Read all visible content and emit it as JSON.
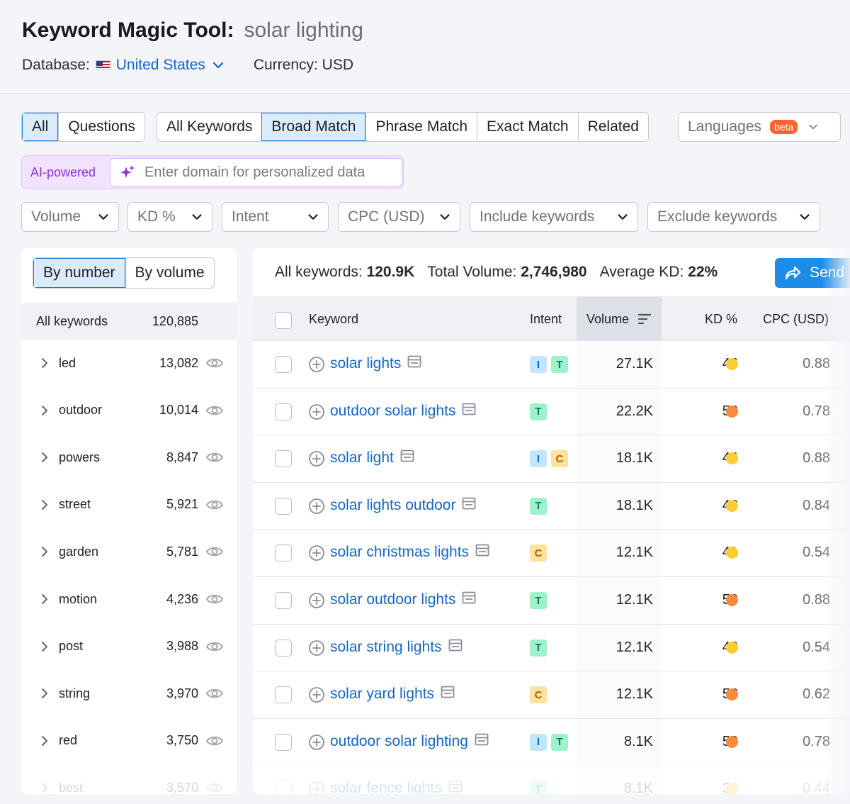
{
  "header": {
    "title": "Keyword Magic Tool:",
    "query": "solar lighting",
    "database_label": "Database:",
    "database_value": "United States",
    "currency": "Currency: USD"
  },
  "question_tabs": [
    "All",
    "Questions"
  ],
  "match_tabs": [
    "All Keywords",
    "Broad Match",
    "Phrase Match",
    "Exact Match",
    "Related"
  ],
  "languages": {
    "label": "Languages",
    "badge": "beta"
  },
  "ai": {
    "label": "AI-powered",
    "placeholder": "Enter domain for personalized data"
  },
  "filters": [
    "Volume",
    "KD %",
    "Intent",
    "CPC (USD)",
    "Include keywords",
    "Exclude keywords"
  ],
  "left_panel": {
    "toggle": [
      "By number",
      "By volume"
    ],
    "all_label": "All keywords",
    "all_count": "120,885",
    "groups": [
      {
        "name": "led",
        "count": "13,082"
      },
      {
        "name": "outdoor",
        "count": "10,014"
      },
      {
        "name": "powers",
        "count": "8,847"
      },
      {
        "name": "street",
        "count": "5,921"
      },
      {
        "name": "garden",
        "count": "5,781"
      },
      {
        "name": "motion",
        "count": "4,236"
      },
      {
        "name": "post",
        "count": "3,988"
      },
      {
        "name": "string",
        "count": "3,970"
      },
      {
        "name": "red",
        "count": "3,750"
      },
      {
        "name": "best",
        "count": "3,570"
      }
    ]
  },
  "summary": {
    "all_label": "All keywords:",
    "all_value": "120.9K",
    "volume_label": "Total Volume:",
    "volume_value": "2,746,980",
    "kd_label": "Average KD:",
    "kd_value": "22%",
    "send_label": "Send"
  },
  "table": {
    "headers": {
      "keyword": "Keyword",
      "intent": "Intent",
      "volume": "Volume",
      "kd": "KD %",
      "cpc": "CPC (USD)"
    },
    "rows": [
      {
        "keyword": "solar lights",
        "intents": [
          "I",
          "T"
        ],
        "volume": "27.1K",
        "kd": "46",
        "kd_color": "#ffcc33",
        "cpc": "0.88"
      },
      {
        "keyword": "outdoor solar lights",
        "intents": [
          "T"
        ],
        "volume": "22.2K",
        "kd": "50",
        "kd_color": "#ff8a3d",
        "cpc": "0.78"
      },
      {
        "keyword": "solar light",
        "intents": [
          "I",
          "C"
        ],
        "volume": "18.1K",
        "kd": "44",
        "kd_color": "#ffcc33",
        "cpc": "0.88"
      },
      {
        "keyword": "solar lights outdoor",
        "intents": [
          "T"
        ],
        "volume": "18.1K",
        "kd": "48",
        "kd_color": "#ffcc33",
        "cpc": "0.84"
      },
      {
        "keyword": "solar christmas lights",
        "intents": [
          "C"
        ],
        "volume": "12.1K",
        "kd": "41",
        "kd_color": "#ffcc33",
        "cpc": "0.54"
      },
      {
        "keyword": "solar outdoor lights",
        "intents": [
          "T"
        ],
        "volume": "12.1K",
        "kd": "50",
        "kd_color": "#ff8a3d",
        "cpc": "0.88"
      },
      {
        "keyword": "solar string lights",
        "intents": [
          "T"
        ],
        "volume": "12.1K",
        "kd": "40",
        "kd_color": "#ffcc33",
        "cpc": "0.54"
      },
      {
        "keyword": "solar yard lights",
        "intents": [
          "C"
        ],
        "volume": "12.1K",
        "kd": "53",
        "kd_color": "#ff8a3d",
        "cpc": "0.62"
      },
      {
        "keyword": "outdoor solar lighting",
        "intents": [
          "I",
          "T"
        ],
        "volume": "8.1K",
        "kd": "50",
        "kd_color": "#ff8a3d",
        "cpc": "0.78"
      },
      {
        "keyword": "solar fence lights",
        "intents": [
          "T"
        ],
        "volume": "8.1K",
        "kd": "38",
        "kd_color": "#ffcc33",
        "cpc": "0.44"
      }
    ]
  },
  "colors": {
    "accent": "#1566c8",
    "primary_button": "#1d8ce8",
    "ai_purple": "#8f36d9",
    "beta": "#ff642d"
  }
}
